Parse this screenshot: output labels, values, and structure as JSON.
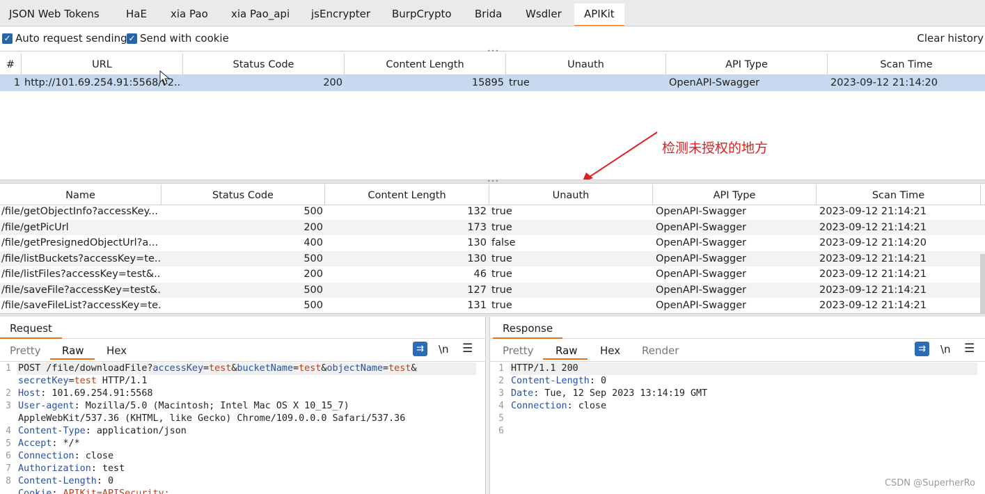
{
  "top_tabs": [
    "JSON Web Tokens",
    "HaE",
    "xia Pao",
    "xia Pao_api",
    "jsEncrypter",
    "BurpCrypto",
    "Brida",
    "Wsdler",
    "APIKit"
  ],
  "active_tab": "APIKit",
  "options": {
    "auto_request_label": "Auto request sending",
    "send_cookie_label": "Send with cookie",
    "clear_history_label": "Clear history"
  },
  "main_table": {
    "columns": [
      "#",
      "URL",
      "Status Code",
      "Content Length",
      "Unauth",
      "API Type",
      "Scan Time"
    ],
    "rows": [
      {
        "num": "1",
        "url": "http://101.69.254.91:5568/v2...",
        "status": "200",
        "length": "15895",
        "unauth": "true",
        "api_type": "OpenAPI-Swagger",
        "scan_time": "2023-09-12 21:14:20"
      }
    ]
  },
  "annotation": "检测未授权的地方",
  "detail_table": {
    "columns": [
      "Name",
      "Status Code",
      "Content Length",
      "Unauth",
      "API Type",
      "Scan Time"
    ],
    "rows": [
      {
        "name": "/file/getObjectInfo?accessKey...",
        "status": "500",
        "length": "132",
        "unauth": "true",
        "api_type": "OpenAPI-Swagger",
        "scan_time": "2023-09-12 21:14:21"
      },
      {
        "name": "/file/getPicUrl",
        "status": "200",
        "length": "173",
        "unauth": "true",
        "api_type": "OpenAPI-Swagger",
        "scan_time": "2023-09-12 21:14:21"
      },
      {
        "name": "/file/getPresignedObjectUrl?a...",
        "status": "400",
        "length": "130",
        "unauth": "false",
        "api_type": "OpenAPI-Swagger",
        "scan_time": "2023-09-12 21:14:20"
      },
      {
        "name": "/file/listBuckets?accessKey=te...",
        "status": "500",
        "length": "130",
        "unauth": "true",
        "api_type": "OpenAPI-Swagger",
        "scan_time": "2023-09-12 21:14:21"
      },
      {
        "name": "/file/listFiles?accessKey=test&...",
        "status": "200",
        "length": "46",
        "unauth": "true",
        "api_type": "OpenAPI-Swagger",
        "scan_time": "2023-09-12 21:14:21"
      },
      {
        "name": "/file/saveFile?accessKey=test&...",
        "status": "500",
        "length": "127",
        "unauth": "true",
        "api_type": "OpenAPI-Swagger",
        "scan_time": "2023-09-12 21:14:21"
      },
      {
        "name": "/file/saveFileList?accessKey=te...",
        "status": "500",
        "length": "131",
        "unauth": "true",
        "api_type": "OpenAPI-Swagger",
        "scan_time": "2023-09-12 21:14:21"
      }
    ]
  },
  "request": {
    "title": "Request",
    "tabs": [
      "Pretty",
      "Raw",
      "Hex"
    ],
    "active_tab": "Raw",
    "line_numbers": [
      "1",
      "2",
      "3",
      "4",
      "5",
      "6",
      "7",
      "8"
    ],
    "lines": {
      "l1a_method": "POST /file/downloadFile?",
      "l1_k1": "accessKey",
      "l1_v1": "test",
      "l1_k2": "bucketName",
      "l1_v2": "test",
      "l1_k3": "objectName",
      "l1_v3": "test",
      "l1b_k4": "secretKey",
      "l1b_v4": "test",
      "l1b_proto": " HTTP/1.1",
      "l2_key": "Host",
      "l2_val": "101.69.254.91:5568",
      "l3_key": "User-agent",
      "l3_val": "Mozilla/5.0 (Macintosh; Intel Mac OS X 10_15_7)",
      "l3b_val": "AppleWebKit/537.36 (KHTML, like Gecko) Chrome/109.0.0.0 Safari/537.36",
      "l4_key": "Content-Type",
      "l4_val": "application/json",
      "l5_key": "Accept",
      "l5_val": "*/*",
      "l6_key": "Connection",
      "l6_val": "close",
      "l7_key": "Authorization",
      "l7_val": "test",
      "l8_key": "Content-Length",
      "l8_val": "0",
      "l9_key": "Cookie",
      "l9_val": "APIKit=APISecurity;"
    }
  },
  "response": {
    "title": "Response",
    "tabs": [
      "Pretty",
      "Raw",
      "Hex",
      "Render"
    ],
    "active_tab": "Raw",
    "line_numbers": [
      "1",
      "2",
      "3",
      "4",
      "5",
      "6"
    ],
    "lines": {
      "l1": "HTTP/1.1 200",
      "l2_key": "Content-Length",
      "l2_val": "0",
      "l3_key": "Date",
      "l3_val": "Tue, 12 Sep 2023 13:14:19 GMT",
      "l4_key": "Connection",
      "l4_val": "close"
    }
  },
  "toolbar_icons": {
    "wrap": "wrap-icon",
    "newline": "\\n",
    "menu": "hamburger-icon"
  },
  "watermark": "CSDN @SuperherRo"
}
